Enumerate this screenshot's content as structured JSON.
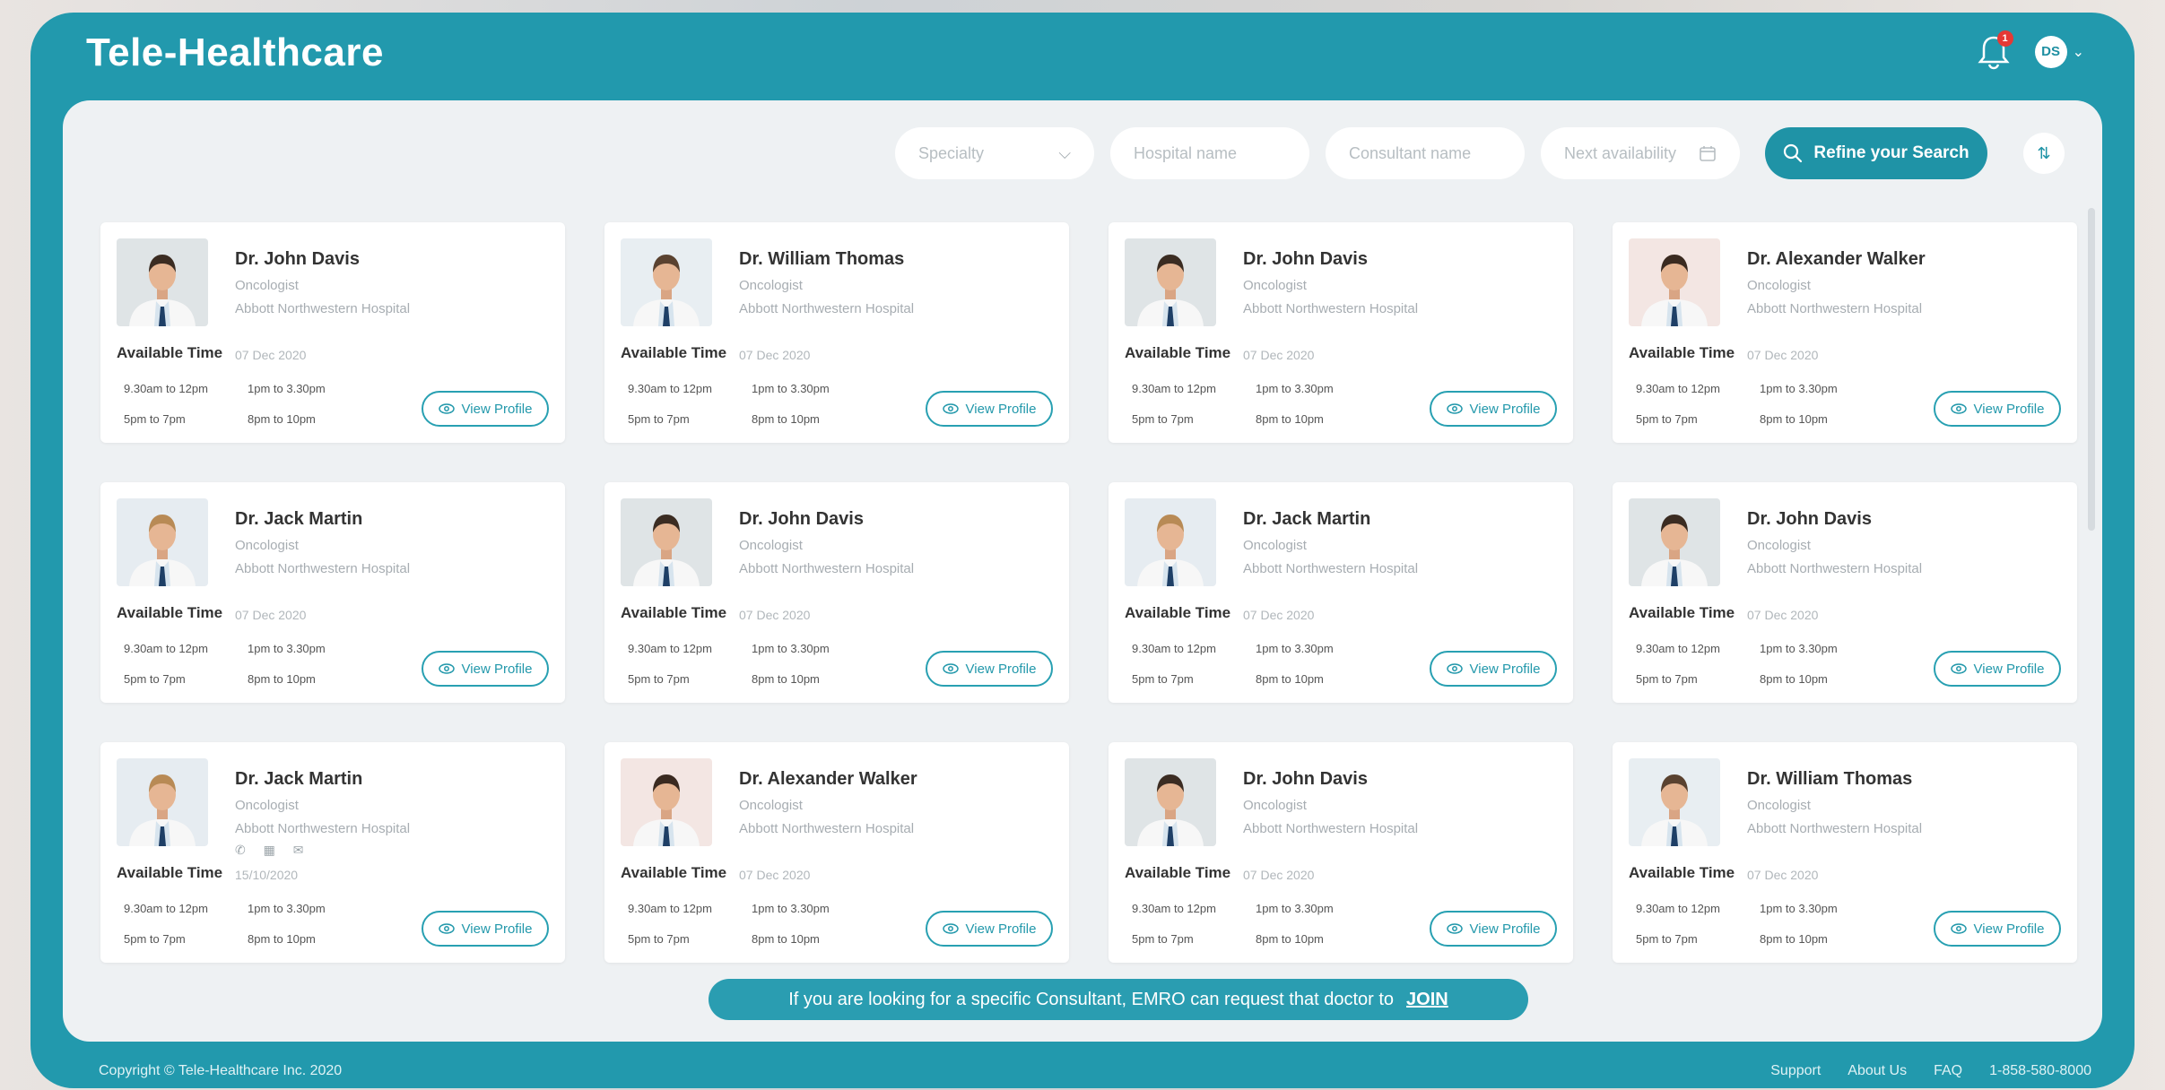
{
  "header": {
    "brand": "Tele-Healthcare",
    "notification_count": "1",
    "user_initials": "DS"
  },
  "filters": {
    "specialty_placeholder": "Specialty",
    "hospital_placeholder": "Hospital name",
    "consultant_placeholder": "Consultant name",
    "availability_placeholder": "Next availability",
    "refine_label": "Refine your Search"
  },
  "common": {
    "available_label": "Available Time",
    "view_label": "View Profile",
    "slot_1": "9.30am to 12pm",
    "slot_2": "1pm to 3.30pm",
    "slot_3": "5pm to 7pm",
    "slot_4": "8pm to 10pm"
  },
  "doctors": [
    {
      "name": "Dr. John Davis",
      "specialty": "Oncologist",
      "hospital": "Abbott Northwestern Hospital",
      "date": "07 Dec 2020",
      "photo": "john"
    },
    {
      "name": "Dr. William Thomas",
      "specialty": "Oncologist",
      "hospital": "Abbott Northwestern Hospital",
      "date": "07 Dec 2020",
      "photo": "william"
    },
    {
      "name": "Dr. John Davis",
      "specialty": "Oncologist",
      "hospital": "Abbott Northwestern Hospital",
      "date": "07 Dec 2020",
      "photo": "john"
    },
    {
      "name": "Dr. Alexander Walker",
      "specialty": "Oncologist",
      "hospital": "Abbott Northwestern Hospital",
      "date": "07 Dec 2020",
      "photo": "alex"
    },
    {
      "name": "Dr. Jack Martin",
      "specialty": "Oncologist",
      "hospital": "Abbott Northwestern Hospital",
      "date": "07 Dec 2020",
      "photo": "jack"
    },
    {
      "name": "Dr. John Davis",
      "specialty": "Oncologist",
      "hospital": "Abbott Northwestern Hospital",
      "date": "07 Dec 2020",
      "photo": "john"
    },
    {
      "name": "Dr. Jack Martin",
      "specialty": "Oncologist",
      "hospital": "Abbott Northwestern Hospital",
      "date": "07 Dec 2020",
      "photo": "jack"
    },
    {
      "name": "Dr. John Davis",
      "specialty": "Oncologist",
      "hospital": "Abbott Northwestern Hospital",
      "date": "07 Dec 2020",
      "photo": "john"
    },
    {
      "name": "Dr. Jack Martin",
      "specialty": "Oncologist",
      "hospital": "Abbott Northwestern Hospital",
      "date": "15/10/2020",
      "photo": "jack",
      "icons": "✆ ▦ ✉"
    },
    {
      "name": "Dr. Alexander Walker",
      "specialty": "Oncologist",
      "hospital": "Abbott Northwestern Hospital",
      "date": "07 Dec 2020",
      "photo": "alex"
    },
    {
      "name": "Dr. John Davis",
      "specialty": "Oncologist",
      "hospital": "Abbott Northwestern Hospital",
      "date": "07 Dec 2020",
      "photo": "john"
    },
    {
      "name": "Dr. William Thomas",
      "specialty": "Oncologist",
      "hospital": "Abbott Northwestern Hospital",
      "date": "07 Dec 2020",
      "photo": "william"
    }
  ],
  "banner": {
    "text": "If you are looking for a specific Consultant, EMRO can request that doctor to",
    "join": "JOIN"
  },
  "footer": {
    "copyright": "Copyright © Tele-Healthcare Inc. 2020",
    "support": "Support",
    "about": "About Us",
    "faq": "FAQ",
    "phone": "1-858-580-8000"
  },
  "colors": {
    "primary": "#2299ad",
    "panel": "#eef1f3"
  }
}
